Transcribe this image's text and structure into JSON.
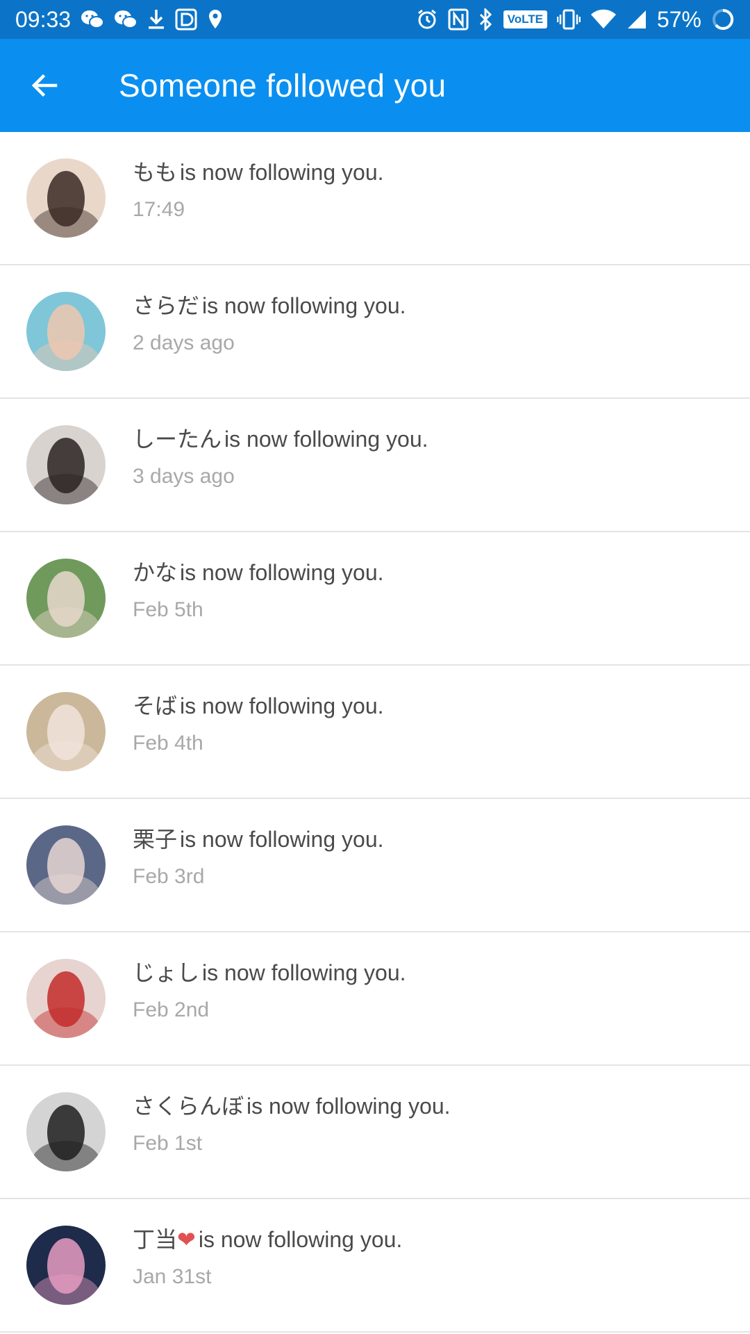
{
  "status_bar": {
    "time": "09:33",
    "battery": "57%",
    "volte_label": "VoLTE",
    "left_icons": [
      "wechat-icon",
      "wechat-icon",
      "download-icon",
      "app-d-icon",
      "location-icon"
    ],
    "right_icons": [
      "alarm-icon",
      "nfc-icon",
      "bluetooth-icon",
      "volte-icon",
      "vibrate-icon",
      "wifi-icon",
      "signal-icon",
      "battery-icon"
    ]
  },
  "app_bar": {
    "title": "Someone followed you",
    "back_icon": "arrow-left-icon"
  },
  "colors": {
    "status_bar": "#0b74c8",
    "app_bar": "#0a8ff0",
    "text_primary": "#4a4a4a",
    "text_secondary": "#a8a8a8",
    "divider": "#e4e4e4"
  },
  "items": [
    {
      "name": "もも",
      "suffix": "is now following you.",
      "time": "17:49",
      "avatar_bg": "#e9d8c9",
      "avatar_fg": "#3a2a24"
    },
    {
      "name": "さらだ",
      "suffix": "is now following you.",
      "time": "2 days ago",
      "avatar_bg": "#7fc6d8",
      "avatar_fg": "#f0c7b0"
    },
    {
      "name": "しーたん",
      "suffix": "is now following you.",
      "time": "3 days ago",
      "avatar_bg": "#d9d3d0",
      "avatar_fg": "#2a2222"
    },
    {
      "name": "かな",
      "suffix": "is now following you.",
      "time": "Feb 5th",
      "avatar_bg": "#6f9a5c",
      "avatar_fg": "#e8d8cc"
    },
    {
      "name": "そば",
      "suffix": "is now following you.",
      "time": "Feb 4th",
      "avatar_bg": "#cbb79a",
      "avatar_fg": "#f1e4dc"
    },
    {
      "name": "栗子",
      "suffix": "is now following you.",
      "time": "Feb 3rd",
      "avatar_bg": "#5b6786",
      "avatar_fg": "#e6d6d2"
    },
    {
      "name": "じょし",
      "suffix": "is now following you.",
      "time": "Feb 2nd",
      "avatar_bg": "#e7d3d0",
      "avatar_fg": "#c22b2b"
    },
    {
      "name": "さくらんぼ",
      "suffix": "is now following you.",
      "time": "Feb 1st",
      "avatar_bg": "#d4d4d4",
      "avatar_fg": "#1f1f1f"
    },
    {
      "name": "丁当",
      "heart": "❤",
      "suffix": "is now following you.",
      "time": "Jan 31st",
      "avatar_bg": "#1e2b4a",
      "avatar_fg": "#e79cc2"
    }
  ]
}
